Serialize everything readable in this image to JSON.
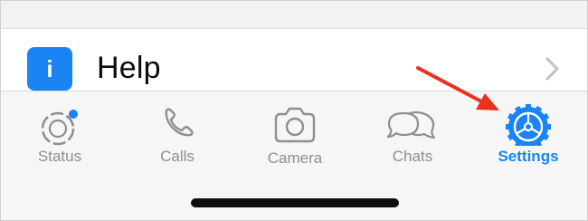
{
  "settings_list": {
    "help_row": {
      "label": "Help",
      "icon": "info-icon",
      "icon_glyph": "i",
      "chevron": "chevron-right-icon"
    }
  },
  "tab_bar": {
    "active_tab": "Settings",
    "accent_color": "#1a84f5",
    "inactive_color": "#8e8e93",
    "tabs": [
      {
        "label": "Status",
        "icon": "status-icon",
        "badge": "blue-dot"
      },
      {
        "label": "Calls",
        "icon": "phone-icon"
      },
      {
        "label": "Camera",
        "icon": "camera-icon"
      },
      {
        "label": "Chats",
        "icon": "chats-bubbles-icon"
      },
      {
        "label": "Settings",
        "icon": "settings-gear-icon"
      }
    ]
  },
  "annotation": {
    "icon": "red-arrow-icon",
    "color": "#e8321f"
  }
}
